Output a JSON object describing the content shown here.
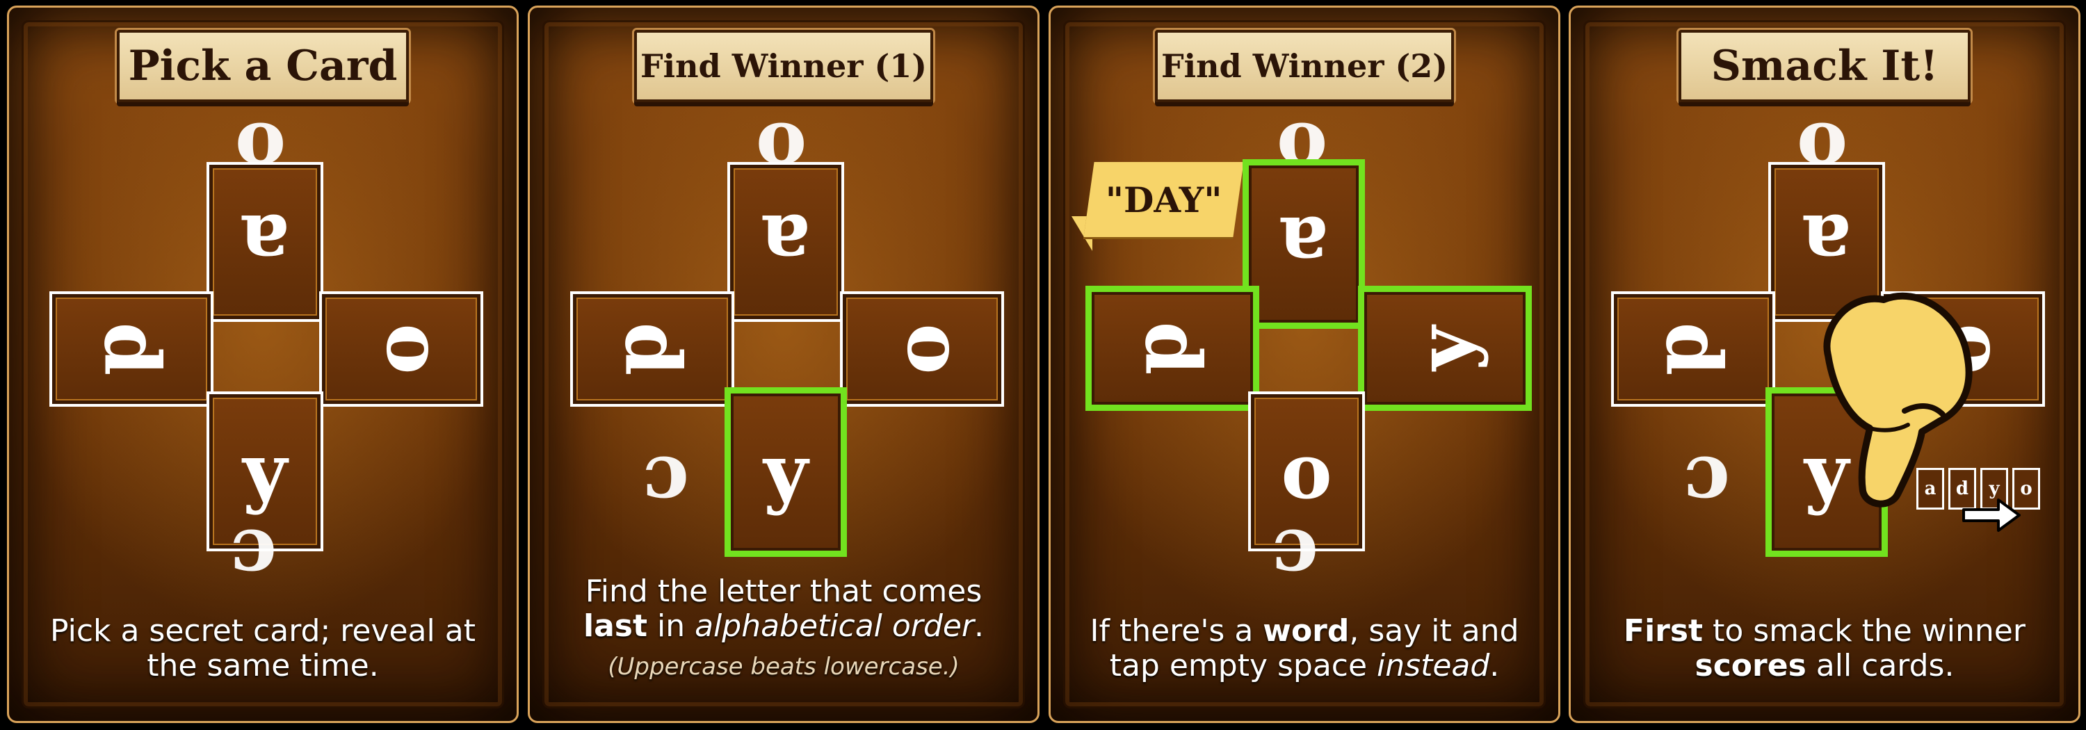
{
  "panels": [
    {
      "title": "Pick a Card",
      "cards": {
        "top": "a",
        "left": "d",
        "right": "o",
        "bottom": "y"
      },
      "caption": "Pick a secret card; reveal at the same time."
    },
    {
      "title": "Find Winner (1)",
      "cards": {
        "top": "a",
        "left": "d",
        "right": "o",
        "bottom": "y"
      },
      "caption_plain1": "Find the letter that comes",
      "caption_bold": "last",
      "caption_plain2": " in ",
      "caption_italic": "alphabetical order",
      "caption_end": ".",
      "note": "(Uppercase beats lowercase.)"
    },
    {
      "title": "Find Winner (2)",
      "speech": "\"DAY\"",
      "cards": {
        "top": "a",
        "left": "d",
        "right": "y",
        "bottom": "o"
      },
      "caption_plain1": "If there's a ",
      "caption_bold": "word",
      "caption_plain2": ", say it and tap empty space ",
      "caption_italic": "instead",
      "caption_end": "."
    },
    {
      "title": "Smack It!",
      "cards": {
        "top": "a",
        "left": "d",
        "right": "o",
        "bottom": "y"
      },
      "mini_cards": [
        "a",
        "d",
        "y",
        "o"
      ],
      "caption_bold1": "First",
      "caption_plain1": " to smack the winner",
      "caption_bold2": "scores",
      "caption_plain2": " all cards."
    }
  ],
  "colors": {
    "highlight": "#72e21f",
    "plaque": "#f3e2b8",
    "speech": "#f7d469",
    "hand": "#f7d469"
  },
  "icons": {
    "hand": "pointing-hand-icon",
    "arrow": "right-arrow-icon"
  }
}
